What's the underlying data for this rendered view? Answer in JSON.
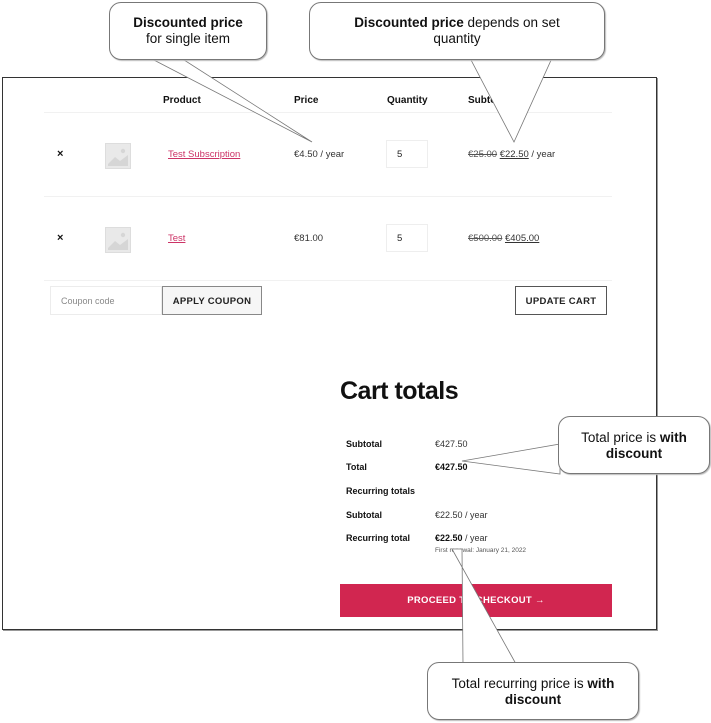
{
  "cart": {
    "headers": {
      "product": "Product",
      "price": "Price",
      "quantity": "Quantity",
      "subtotal": "Subtotal"
    },
    "rows": [
      {
        "remove": "×",
        "product_name": "Test Subscription",
        "price": "€4.50 / year",
        "quantity": "5",
        "subtotal_old": "€25.00",
        "subtotal_new": "€22.50",
        "subtotal_suffix": " / year"
      },
      {
        "remove": "×",
        "product_name": "Test",
        "price": "€81.00",
        "quantity": "5",
        "subtotal_old": "€500.00",
        "subtotal_new": "€405.00",
        "subtotal_suffix": ""
      }
    ],
    "coupon_placeholder": "Coupon code",
    "apply_coupon_label": "APPLY COUPON",
    "update_cart_label": "UPDATE CART"
  },
  "totals": {
    "title": "Cart totals",
    "subtotal_label": "Subtotal",
    "subtotal_value": "€427.50",
    "total_label": "Total",
    "total_value": "€427.50",
    "recurring_heading": "Recurring totals",
    "recurring_subtotal_label": "Subtotal",
    "recurring_subtotal_value": "€22.50 / year",
    "recurring_total_label": "Recurring total",
    "recurring_total_amount": "€22.50",
    "recurring_total_suffix": " / year",
    "first_renewal": "First renewal: January 21, 2022",
    "checkout_label": "PROCEED TO CHECKOUT →"
  },
  "callouts": {
    "single_item": {
      "bold": "Discounted price",
      "text": "for single item"
    },
    "quantity": {
      "bold": "Discounted price",
      "text": " depends on set quantity"
    },
    "total": {
      "text": "Total price is ",
      "bold": "with discount"
    },
    "recurring": {
      "text": "Total recurring price is ",
      "bold": "with discount"
    }
  },
  "colors": {
    "accent": "#d12650",
    "link": "#cc3366"
  }
}
